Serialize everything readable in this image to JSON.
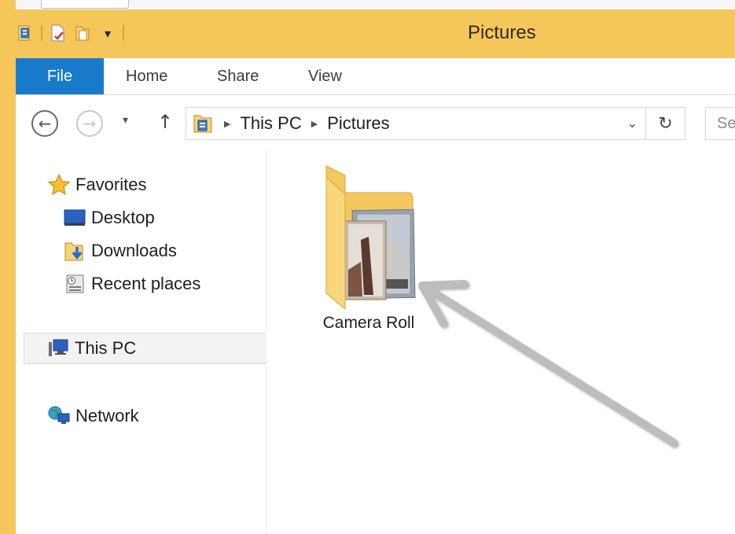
{
  "window": {
    "title": "Pictures",
    "accent_color": "#f5c65a",
    "file_tab_color": "#1979ca"
  },
  "quick_access_toolbar": {
    "icons": [
      "properties-icon",
      "new-file-icon",
      "new-folder-icon",
      "customize-qat-icon"
    ],
    "customize_glyph": "▾"
  },
  "ribbon": {
    "file_label": "File",
    "tabs": [
      {
        "label": "Home"
      },
      {
        "label": "Share"
      },
      {
        "label": "View"
      }
    ]
  },
  "navigation": {
    "back_glyph": "←",
    "forward_glyph": "→",
    "recent_glyph": "▾",
    "up_glyph": "↑",
    "breadcrumb": [
      "This PC",
      "Pictures"
    ],
    "crumb_separator": "▶",
    "dropdown_glyph": "⌄",
    "refresh_glyph": "↻",
    "search_placeholder": "Search Pictures"
  },
  "sidebar": {
    "favorites_label": "Favorites",
    "favorites_items": [
      {
        "label": "Desktop",
        "icon": "desktop-icon"
      },
      {
        "label": "Downloads",
        "icon": "downloads-icon"
      },
      {
        "label": "Recent places",
        "icon": "recent-places-icon"
      }
    ],
    "this_pc_label": "This PC",
    "network_label": "Network"
  },
  "content": {
    "items": [
      {
        "label": "Camera Roll",
        "icon": "folder-with-photos-icon"
      }
    ],
    "annotation": "arrow-pointing-to-camera-roll"
  }
}
